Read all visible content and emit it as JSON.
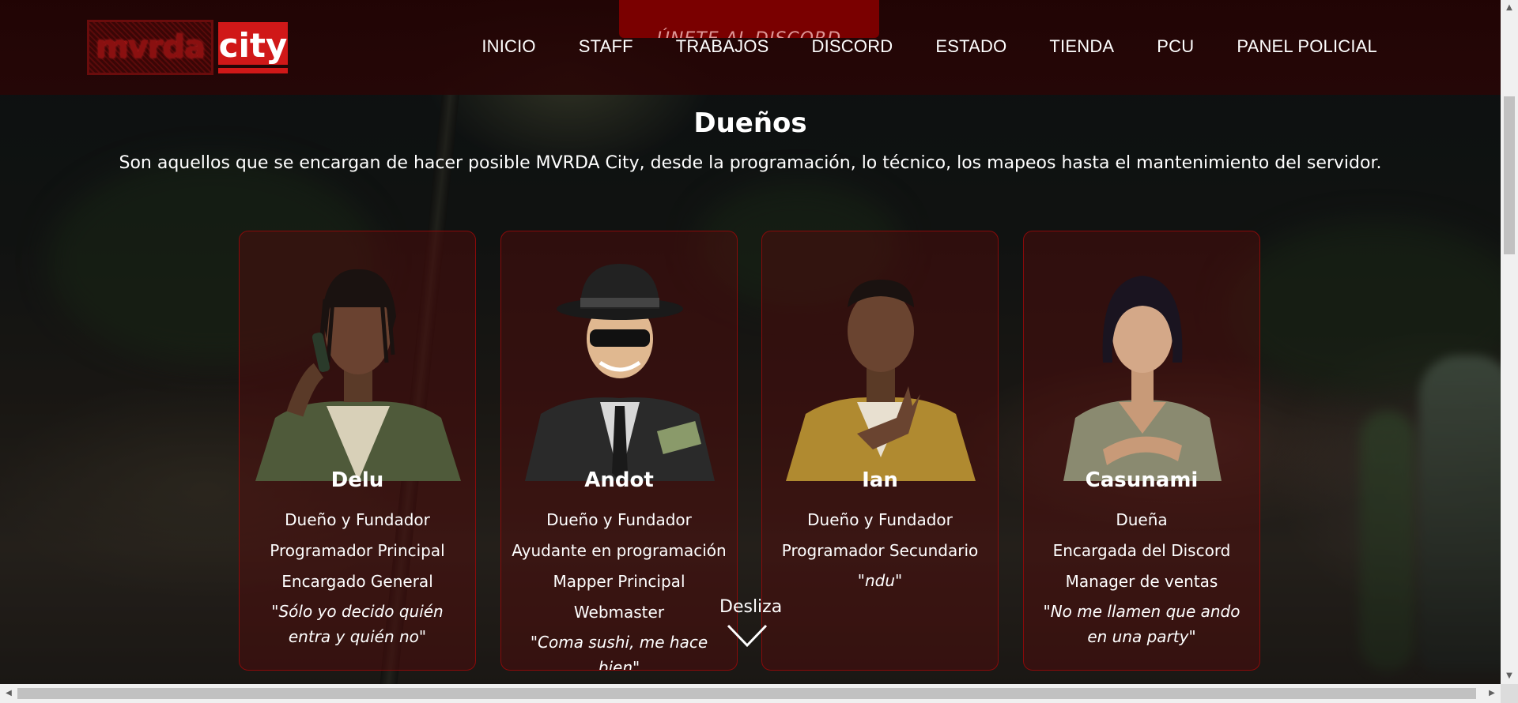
{
  "header": {
    "discord_banner": "ÚNETE AL DISCORD",
    "logo": {
      "left_text": "mvrda",
      "right_text": "city"
    },
    "nav": [
      {
        "label": "INICIO"
      },
      {
        "label": "STAFF"
      },
      {
        "label": "TRABAJOS"
      },
      {
        "label": "DISCORD"
      },
      {
        "label": "ESTADO"
      },
      {
        "label": "TIENDA"
      },
      {
        "label": "PCU"
      },
      {
        "label": "PANEL POLICIAL"
      }
    ]
  },
  "section": {
    "title": "Dueños",
    "description": "Son aquellos que se encargan de hacer posible MVRDA City, desde la programación, lo técnico, los mapeos hasta el mantenimiento del servidor."
  },
  "cards": [
    {
      "name": "Delu",
      "roles": [
        "Dueño y Fundador",
        "Programador Principal",
        "Encargado General"
      ],
      "quote": "\"Sólo yo decido quién entra y quién no\""
    },
    {
      "name": "Andot",
      "roles": [
        "Dueño y Fundador",
        "Ayudante en programación",
        "Mapper Principal",
        "Webmaster"
      ],
      "quote": "\"Coma sushi, me hace bien\""
    },
    {
      "name": "Ian",
      "roles": [
        "Dueño y Fundador",
        "Programador Secundario"
      ],
      "quote": "\"ndu\""
    },
    {
      "name": "Casunami",
      "roles": [
        "Dueña",
        "Encargada del Discord",
        "Manager de ventas"
      ],
      "quote": "\"No me llamen que ando en una party\""
    }
  ],
  "scroll_hint": {
    "label": "Desliza",
    "icon": "chevron-down-icon"
  },
  "colors": {
    "accent": "#7a0000",
    "card_border": "#8a0a0a",
    "logo_red": "#d01818"
  }
}
